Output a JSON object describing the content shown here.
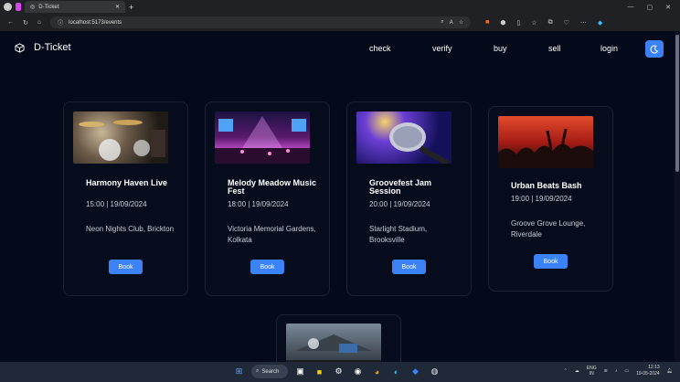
{
  "browser": {
    "tab_title": "D-Ticket",
    "url": "localhost:5173/events",
    "colors": {
      "chrome": "#202124"
    }
  },
  "nav": {
    "brand": "D-Ticket",
    "links": [
      "check",
      "verify",
      "buy",
      "sell",
      "login"
    ],
    "accent": "#3b82f6"
  },
  "events": [
    {
      "title": "Harmony Haven Live",
      "time": "15:00 | 19/09/2024",
      "venue": "Neon Nights Club, Brickton",
      "button": "Book"
    },
    {
      "title": "Melody Meadow Music Fest",
      "time": "18:00 | 19/09/2024",
      "venue": "Victoria Memorial Gardens, Kolkata",
      "button": "Book"
    },
    {
      "title": "Groovefest Jam Session",
      "time": "20:00 | 19/09/2024",
      "venue": "Starlight Stadium, Brooksville",
      "button": "Book"
    },
    {
      "title": "Urban Beats Bash",
      "time": "19:00 | 19/09/2024",
      "venue": "Groove Grove Lounge, Riverdale",
      "button": "Book"
    }
  ],
  "taskbar": {
    "search_label": "Search",
    "lang_top": "ENG",
    "lang_bottom": "IN",
    "time": "12:13",
    "date": "19-05-2024"
  }
}
